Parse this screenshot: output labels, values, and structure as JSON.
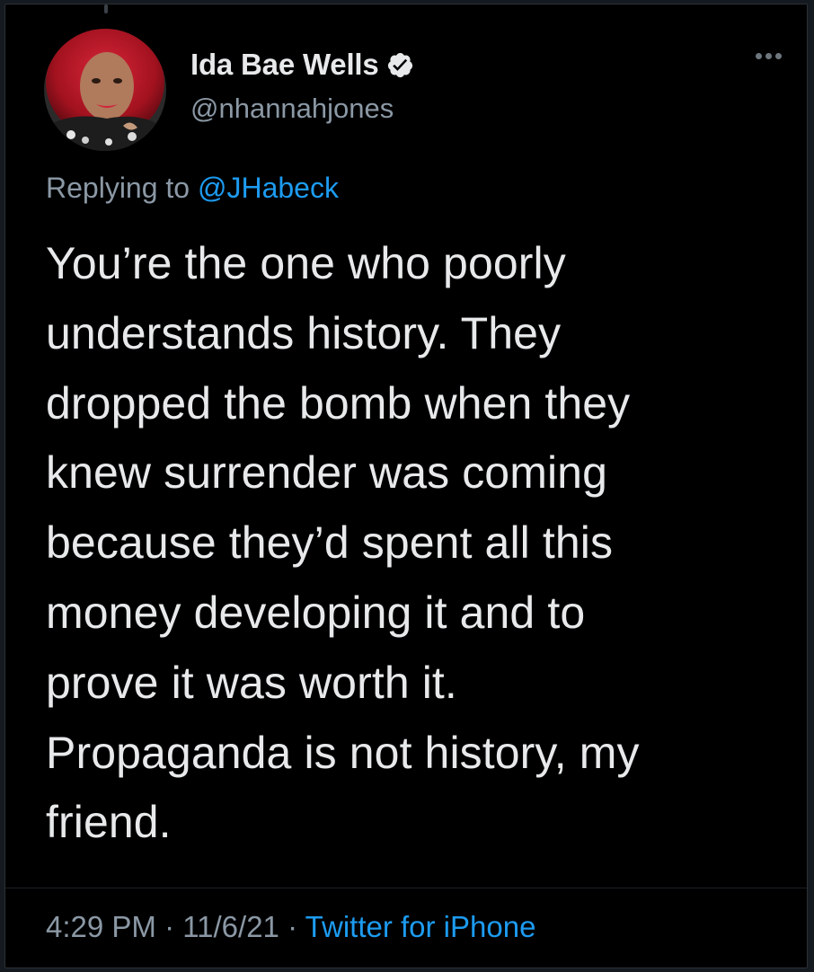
{
  "tweet": {
    "author": {
      "display_name": "Ida Bae Wells",
      "handle": "@nhannahjones",
      "verified": true,
      "avatar_icon": "profile-photo"
    },
    "replying_prefix": "Replying to",
    "replying_to": "@JHabeck",
    "text": "You’re the one who poorly\nunderstands history. They\ndropped the bomb when they\nknew surrender was coming\nbecause they’d spent all this\nmoney developing it and to\nprove it was worth it.\nPropaganda is not history, my\nfriend.",
    "time": "4:29 PM",
    "separator": "·",
    "date": "11/6/21",
    "source": "Twitter for iPhone"
  },
  "colors": {
    "background": "#000000",
    "primary_text": "#e7e9ea",
    "secondary_text": "#8b98a5",
    "accent": "#1d9bf0"
  },
  "icons": {
    "verified": "verified-badge-icon",
    "more": "more-options-icon"
  }
}
